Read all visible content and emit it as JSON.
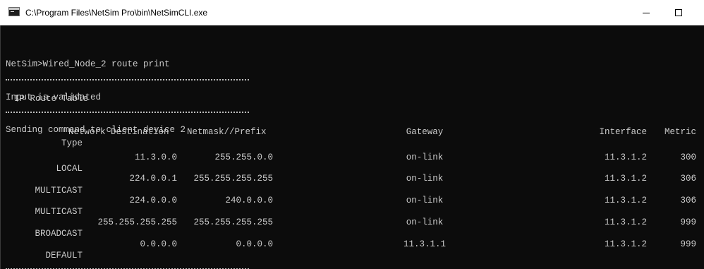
{
  "window": {
    "title": "C:\\Program Files\\NetSim Pro\\bin\\NetSimCLI.exe",
    "app_icon": "console-app-icon",
    "controls": {
      "minimize_icon": "minimize-icon",
      "maximize_icon": "maximize-icon",
      "close_icon": "close-icon"
    }
  },
  "console": {
    "lines": [
      "NetSim>Wired_Node_2 route print",
      "Input is validated",
      "Sending command to client device 2"
    ],
    "separator": "===========================================",
    "table_title": "IP Route Table",
    "columns": {
      "destination": "Network Destination",
      "netmask": "Netmask//Prefix",
      "gateway": "Gateway",
      "interface": "Interface",
      "metric": "Metric",
      "type": "Type"
    },
    "routes": [
      {
        "destination": "11.3.0.0",
        "netmask": "255.255.0.0",
        "gateway": "on-link",
        "interface": "11.3.1.2",
        "metric": "300",
        "type": "LOCAL"
      },
      {
        "destination": "224.0.0.1",
        "netmask": "255.255.255.255",
        "gateway": "on-link",
        "interface": "11.3.1.2",
        "metric": "306",
        "type": "MULTICAST"
      },
      {
        "destination": "224.0.0.0",
        "netmask": "240.0.0.0",
        "gateway": "on-link",
        "interface": "11.3.1.2",
        "metric": "306",
        "type": "MULTICAST"
      },
      {
        "destination": "255.255.255.255",
        "netmask": "255.255.255.255",
        "gateway": "on-link",
        "interface": "11.3.1.2",
        "metric": "999",
        "type": "BROADCAST"
      },
      {
        "destination": "0.0.0.0",
        "netmask": "0.0.0.0",
        "gateway": "11.3.1.1",
        "interface": "11.3.1.2",
        "metric": "999",
        "type": "DEFAULT"
      }
    ]
  },
  "colors": {
    "console_background": "#0c0c0c",
    "console_text": "#cccccc",
    "titlebar_background": "#ffffff"
  }
}
